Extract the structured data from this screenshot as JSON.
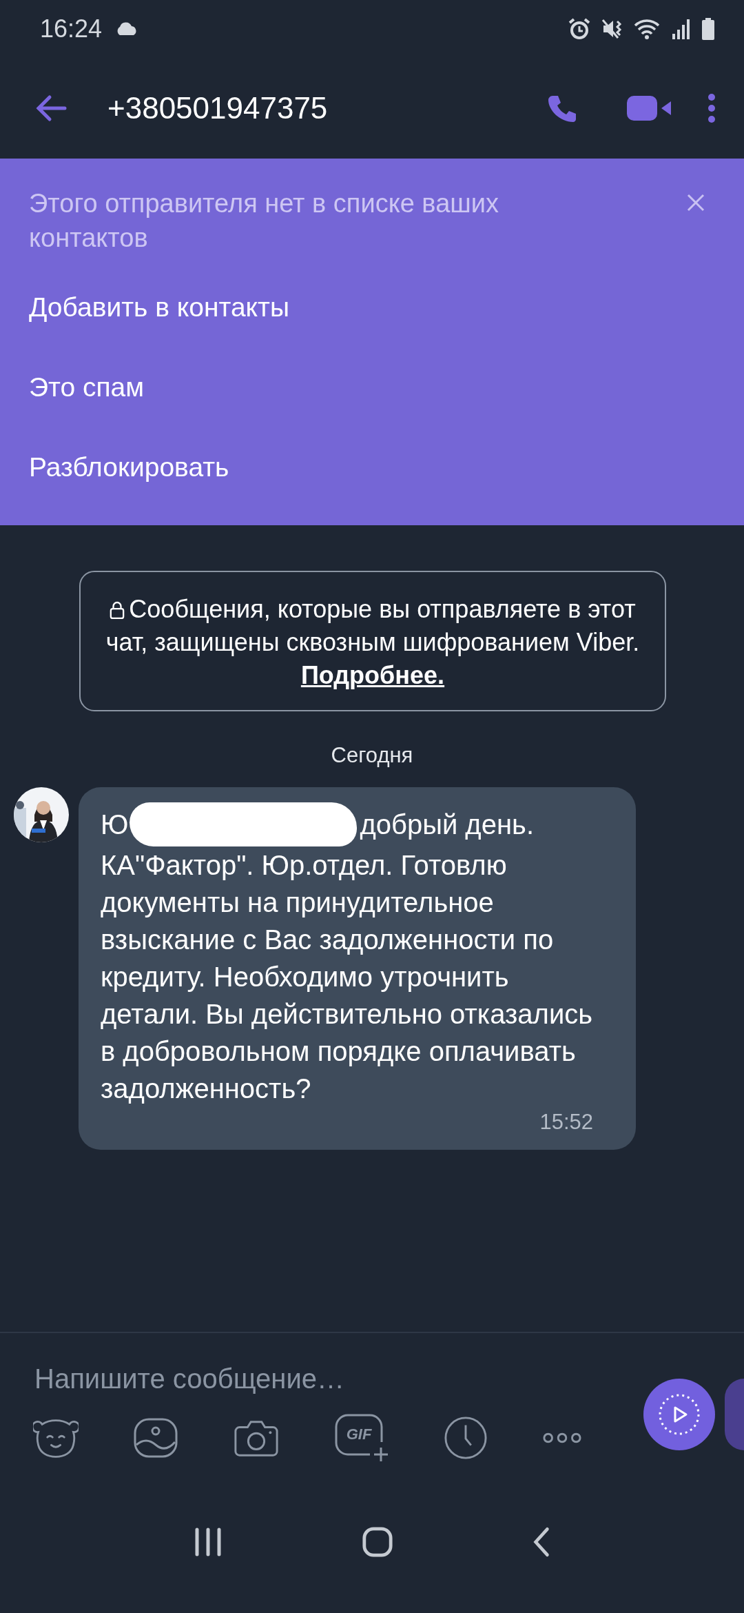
{
  "status_bar": {
    "time": "16:24"
  },
  "header": {
    "title": "+380501947375"
  },
  "unknown_sender_banner": {
    "text": "Этого отправителя нет в списке ваших контактов",
    "actions": [
      {
        "label": "Добавить в контакты"
      },
      {
        "label": "Это спам"
      },
      {
        "label": "Разблокировать"
      }
    ]
  },
  "encryption_notice": {
    "text": "Сообщения, которые вы отправляете в этот чат, защищены сквозным шифрованием Viber.",
    "link": "Подробнее."
  },
  "date_separator": "Сегодня",
  "messages": [
    {
      "text_before_redaction": "Ю",
      "redacted": true,
      "text_after_redaction": "добрый день.",
      "text": "КА\"Фактор\". Юр.отдел. Готовлю документы на принудительное взыскание с Вас задолженности по кредиту. Необходимо утрочнить детали. Вы действительно отказались в добровольном порядке оплачивать задолженность?",
      "time": "15:52"
    }
  ],
  "composer": {
    "placeholder": "Напишите сообщение…",
    "gif_label": "GIF"
  }
}
